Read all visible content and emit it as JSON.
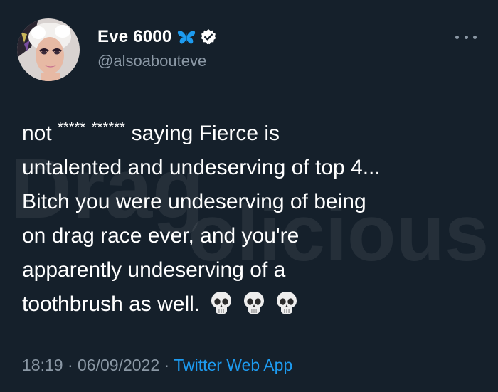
{
  "user": {
    "display_name": "Eve 6000",
    "handle": "@alsoabouteve",
    "verified": true
  },
  "tweet": {
    "line1_before": "not",
    "line1_censor_1": "*****",
    "line1_censor_2": "******",
    "line1_after": "saying Fierce is",
    "line2": "untalented and undeserving of top 4...",
    "line3": "Bitch you were undeserving of being",
    "line4": "on drag race ever, and you're",
    "line5": "apparently undeserving of a",
    "line6": "toothbrush as well.",
    "emoji": [
      "skull-icon",
      "skull-icon",
      "skull-icon"
    ]
  },
  "meta": {
    "time": "18:19",
    "sep1": "·",
    "date": "06/09/2022",
    "sep2": "·",
    "source": "Twitter Web App"
  },
  "watermark": {
    "line1": "Drag",
    "line2": "olicious"
  },
  "colors": {
    "background": "#15202b",
    "text": "#ffffff",
    "secondary": "#8b98a5",
    "link": "#1d9bf0",
    "verified": "#ffffff",
    "butterfly": "#1d9bf0"
  }
}
